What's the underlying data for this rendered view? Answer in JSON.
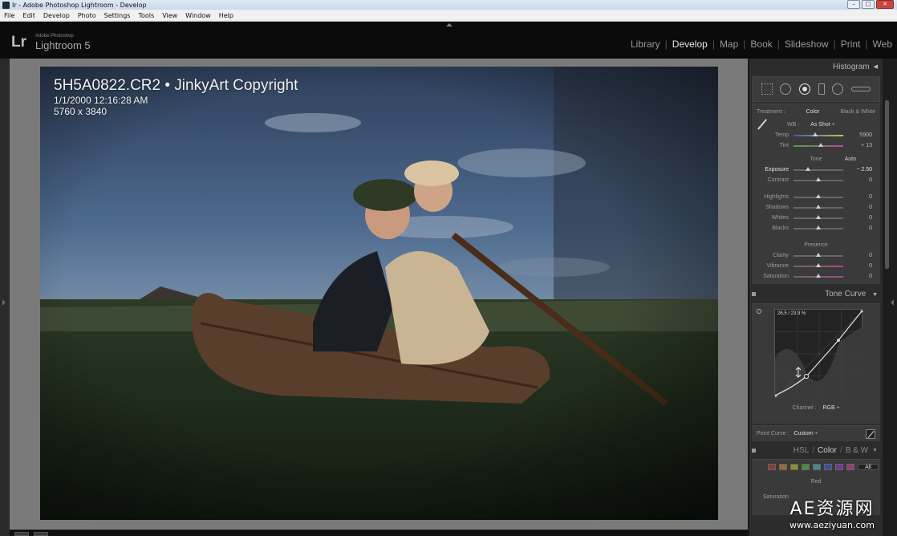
{
  "window": {
    "title": "Ir - Adobe Photoshop Lightroom - Develop",
    "buttons": {
      "minimize": "–",
      "maximize": "□",
      "close": "✕"
    }
  },
  "menubar": [
    "File",
    "Edit",
    "Develop",
    "Photo",
    "Settings",
    "Tools",
    "View",
    "Window",
    "Help"
  ],
  "brand": {
    "logo": "Lr",
    "small": "Adobe Photoshop",
    "big": "Lightroom 5"
  },
  "modules": [
    {
      "label": "Library",
      "active": false
    },
    {
      "label": "Develop",
      "active": true
    },
    {
      "label": "Map",
      "active": false
    },
    {
      "label": "Book",
      "active": false
    },
    {
      "label": "Slideshow",
      "active": false
    },
    {
      "label": "Print",
      "active": false
    },
    {
      "label": "Web",
      "active": false
    }
  ],
  "photo": {
    "filename": "5H5A0822.CR2 • JinkyArt Copyright",
    "date": "1/1/2000 12:16:28 AM",
    "dimensions": "5760 x 3840"
  },
  "panels": {
    "histogram": {
      "title": "Histogram",
      "icon": "◀"
    },
    "basic": {
      "treatment_label": "Treatment :",
      "treatment_color": "Color",
      "treatment_bw": "Black & White",
      "wb_label": "WB :",
      "wb_value": "As Shot ÷",
      "temp": {
        "label": "Temp",
        "value": "5900",
        "pos": 0.43
      },
      "tint": {
        "label": "Tint",
        "value": "+ 13",
        "pos": 0.55
      },
      "tone_label": "Tone",
      "auto_label": "Auto",
      "exposure": {
        "label": "Exposure",
        "value": "− 2.50",
        "pos": 0.29
      },
      "contrast": {
        "label": "Contrast",
        "value": "0",
        "pos": 0.5
      },
      "highlights": {
        "label": "Highlights",
        "value": "0",
        "pos": 0.5
      },
      "shadows": {
        "label": "Shadows",
        "value": "0",
        "pos": 0.5
      },
      "whites": {
        "label": "Whites",
        "value": "0",
        "pos": 0.5
      },
      "blacks": {
        "label": "Blacks",
        "value": "0",
        "pos": 0.5
      },
      "presence_label": "Presence",
      "clarity": {
        "label": "Clarity",
        "value": "0",
        "pos": 0.5
      },
      "vibrance": {
        "label": "Vibrance",
        "value": "0",
        "pos": 0.5
      },
      "saturation": {
        "label": "Saturation",
        "value": "0",
        "pos": 0.5
      }
    },
    "tone_curve": {
      "title": "Tone Curve",
      "icon": "▼",
      "readout": "26.5 / 23.9 %",
      "channel_label": "Channel :",
      "channel_value": "RGB ÷",
      "point_curve_label": "Point Curve :",
      "point_curve_value": "Custom ÷"
    },
    "hsl": {
      "tab_hsl": "HSL",
      "tab_color": "Color",
      "tab_bw": "B & W",
      "icon": "▼",
      "swatches": [
        "#8a3a3a",
        "#9a6a2a",
        "#8f8f2e",
        "#4f8a3a",
        "#3f8f8f",
        "#3a4f9a",
        "#6a3a9a",
        "#9a3a7a"
      ],
      "all_label": "All",
      "red_label": "Red",
      "saturation_label": "Saturation"
    }
  },
  "watermark": {
    "big": "AE资源网",
    "small": "www.aeziyuan.com"
  }
}
